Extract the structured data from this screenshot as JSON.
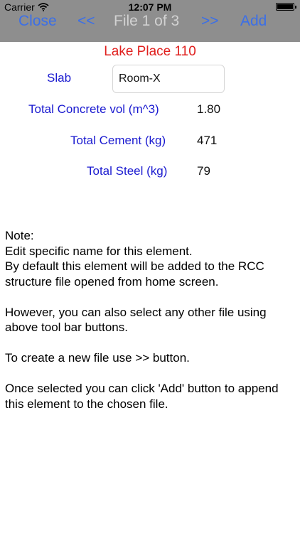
{
  "status_bar": {
    "carrier": "Carrier",
    "time": "12:07 PM",
    "battery_level": 1.0
  },
  "toolbar": {
    "close_label": "Close",
    "prev_label": "<<",
    "file_label": "File 1 of 3",
    "next_label": ">>",
    "add_label": "Add"
  },
  "heading": "Lake Place 110",
  "form": {
    "slab_label": "Slab",
    "slab_value": "Room-X",
    "concrete_label": "Total Concrete vol (m^3)",
    "concrete_value": "1.80",
    "cement_label": "Total Cement (kg)",
    "cement_value": "471",
    "steel_label": "Total Steel (kg)",
    "steel_value": "79"
  },
  "note": {
    "line1": "Note:",
    "line2": "Edit specific name for this element.",
    "line3": "By default this element will be added to the RCC structure file opened from home screen.",
    "line4": "However, you can also select any other file using above tool bar buttons.",
    "line5": "To create a new file use >> button.",
    "line6": "Once selected you can click 'Add' button to append this element to the chosen file."
  },
  "colors": {
    "toolbar_bg": "#8e8e8e",
    "toolbar_button": "#3b6fe8",
    "toolbar_title": "#d2d2d2",
    "heading": "#e0201e",
    "label": "#1a1ad0"
  },
  "icons": {
    "wifi": "wifi-icon",
    "battery": "battery-icon"
  }
}
